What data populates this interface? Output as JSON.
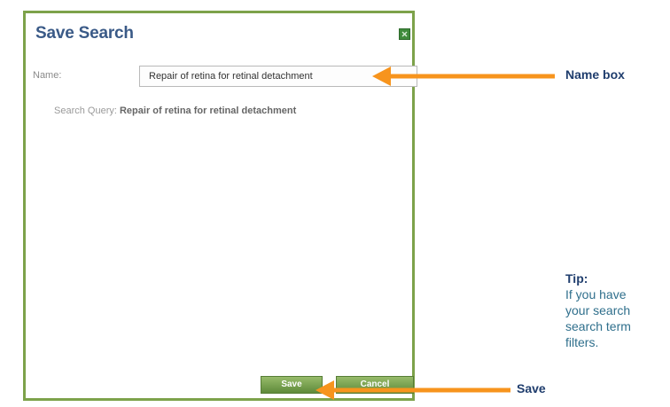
{
  "dialog": {
    "title": "Save Search",
    "name_label": "Name:",
    "name_value": "Repair of retina for retinal detachment",
    "query_label": "Search Query:",
    "query_value": "Repair of retina for retinal detachment",
    "save_label": "Save",
    "cancel_label": "Cancel"
  },
  "annotations": {
    "name_box": "Name box",
    "save": "Save",
    "tip_title": "Tip:",
    "tip_lines": [
      "If you have",
      "your search",
      "search term",
      "filters."
    ]
  },
  "colors": {
    "accent_arrow": "#f7941d",
    "dialog_border": "#7da24a",
    "title": "#3a5a87"
  }
}
